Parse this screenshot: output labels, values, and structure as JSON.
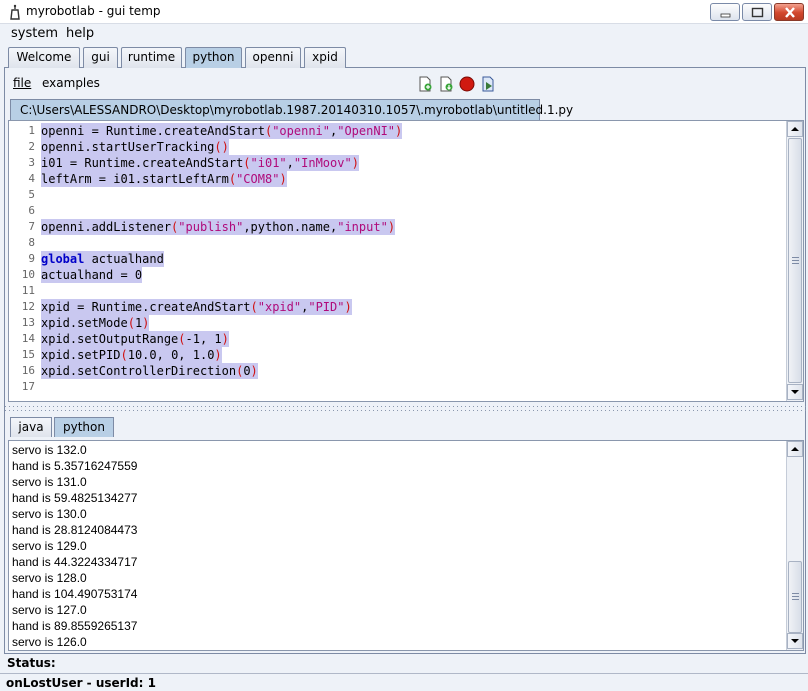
{
  "window": {
    "title": "myrobotlab - gui temp"
  },
  "menu": [
    "system",
    "help"
  ],
  "tabs": [
    {
      "label": "Welcome",
      "active": false
    },
    {
      "label": "gui",
      "active": false
    },
    {
      "label": "runtime",
      "active": false
    },
    {
      "label": "python",
      "active": true
    },
    {
      "label": "openni",
      "active": false
    },
    {
      "label": "xpid",
      "active": false
    }
  ],
  "python_menu": {
    "file": "file",
    "examples": "examples"
  },
  "toolbar_icons": [
    "new-script-icon",
    "save-script-icon",
    "stop-icon",
    "execute-icon"
  ],
  "editor": {
    "file_tab": "C:\\Users\\ALESSANDRO\\Desktop\\myrobotlab.1987.20140310.1057\\.myrobotlab\\untitled.1.py",
    "lines": [
      {
        "n": "1",
        "segs": [
          [
            "t",
            "openni = Runtime.createAndStart"
          ],
          [
            "p",
            "("
          ],
          [
            "s",
            "\"openni\""
          ],
          [
            "t",
            ","
          ],
          [
            "s",
            "\"OpenNI\""
          ],
          [
            "p",
            ")"
          ]
        ]
      },
      {
        "n": "2",
        "segs": [
          [
            "t",
            "openni.startUserTracking"
          ],
          [
            "p",
            "()"
          ]
        ]
      },
      {
        "n": "3",
        "segs": [
          [
            "t",
            "i01 = Runtime.createAndStart"
          ],
          [
            "p",
            "("
          ],
          [
            "s",
            "\"i01\""
          ],
          [
            "t",
            ","
          ],
          [
            "s",
            "\"InMoov\""
          ],
          [
            "p",
            ")"
          ]
        ]
      },
      {
        "n": "4",
        "segs": [
          [
            "t",
            "leftArm = i01.startLeftArm"
          ],
          [
            "p",
            "("
          ],
          [
            "s",
            "\"COM8\""
          ],
          [
            "p",
            ")"
          ]
        ]
      },
      {
        "n": "5",
        "segs": []
      },
      {
        "n": "6",
        "segs": []
      },
      {
        "n": "7",
        "segs": [
          [
            "t",
            "openni.addListener"
          ],
          [
            "p",
            "("
          ],
          [
            "s",
            "\"publish\""
          ],
          [
            "t",
            ",python.name,"
          ],
          [
            "s",
            "\"input\""
          ],
          [
            "p",
            ")"
          ]
        ]
      },
      {
        "n": "8",
        "segs": []
      },
      {
        "n": "9",
        "segs": [
          [
            "k",
            "global"
          ],
          [
            "t",
            " actualhand"
          ]
        ]
      },
      {
        "n": "10",
        "segs": [
          [
            "t",
            "actualhand = 0"
          ]
        ]
      },
      {
        "n": "11",
        "segs": []
      },
      {
        "n": "12",
        "segs": [
          [
            "t",
            "xpid = Runtime.createAndStart"
          ],
          [
            "p",
            "("
          ],
          [
            "s",
            "\"xpid\""
          ],
          [
            "t",
            ","
          ],
          [
            "s",
            "\"PID\""
          ],
          [
            "p",
            ")"
          ]
        ]
      },
      {
        "n": "13",
        "segs": [
          [
            "t",
            "xpid.setMode"
          ],
          [
            "p",
            "("
          ],
          [
            "t",
            "1"
          ],
          [
            "p",
            ")"
          ]
        ]
      },
      {
        "n": "14",
        "segs": [
          [
            "t",
            "xpid.setOutputRange"
          ],
          [
            "p",
            "("
          ],
          [
            "t",
            "-1, 1"
          ],
          [
            "p",
            ")"
          ]
        ]
      },
      {
        "n": "15",
        "segs": [
          [
            "t",
            "xpid.setPID"
          ],
          [
            "p",
            "("
          ],
          [
            "t",
            "10.0, 0, 1.0"
          ],
          [
            "p",
            ")"
          ]
        ]
      },
      {
        "n": "16",
        "segs": [
          [
            "t",
            "xpid.setControllerDirection"
          ],
          [
            "p",
            "("
          ],
          [
            "t",
            "0"
          ],
          [
            "p",
            ")"
          ]
        ]
      },
      {
        "n": "17",
        "segs": []
      }
    ]
  },
  "bottom_tabs": [
    {
      "label": "java",
      "active": false
    },
    {
      "label": "python",
      "active": true
    }
  ],
  "console_lines": [
    "servo is 132.0",
    "hand is 5.35716247559",
    "servo is 131.0",
    "hand is 59.4825134277",
    "servo is 130.0",
    "hand is 28.8124084473",
    "servo is 129.0",
    "hand is 44.3224334717",
    "servo is 128.0",
    "hand is 104.490753174",
    "servo is 127.0",
    "hand is 89.8559265137",
    "servo is 126.0"
  ],
  "status": {
    "label": "Status:",
    "message": "onLostUser - userId: 1"
  }
}
